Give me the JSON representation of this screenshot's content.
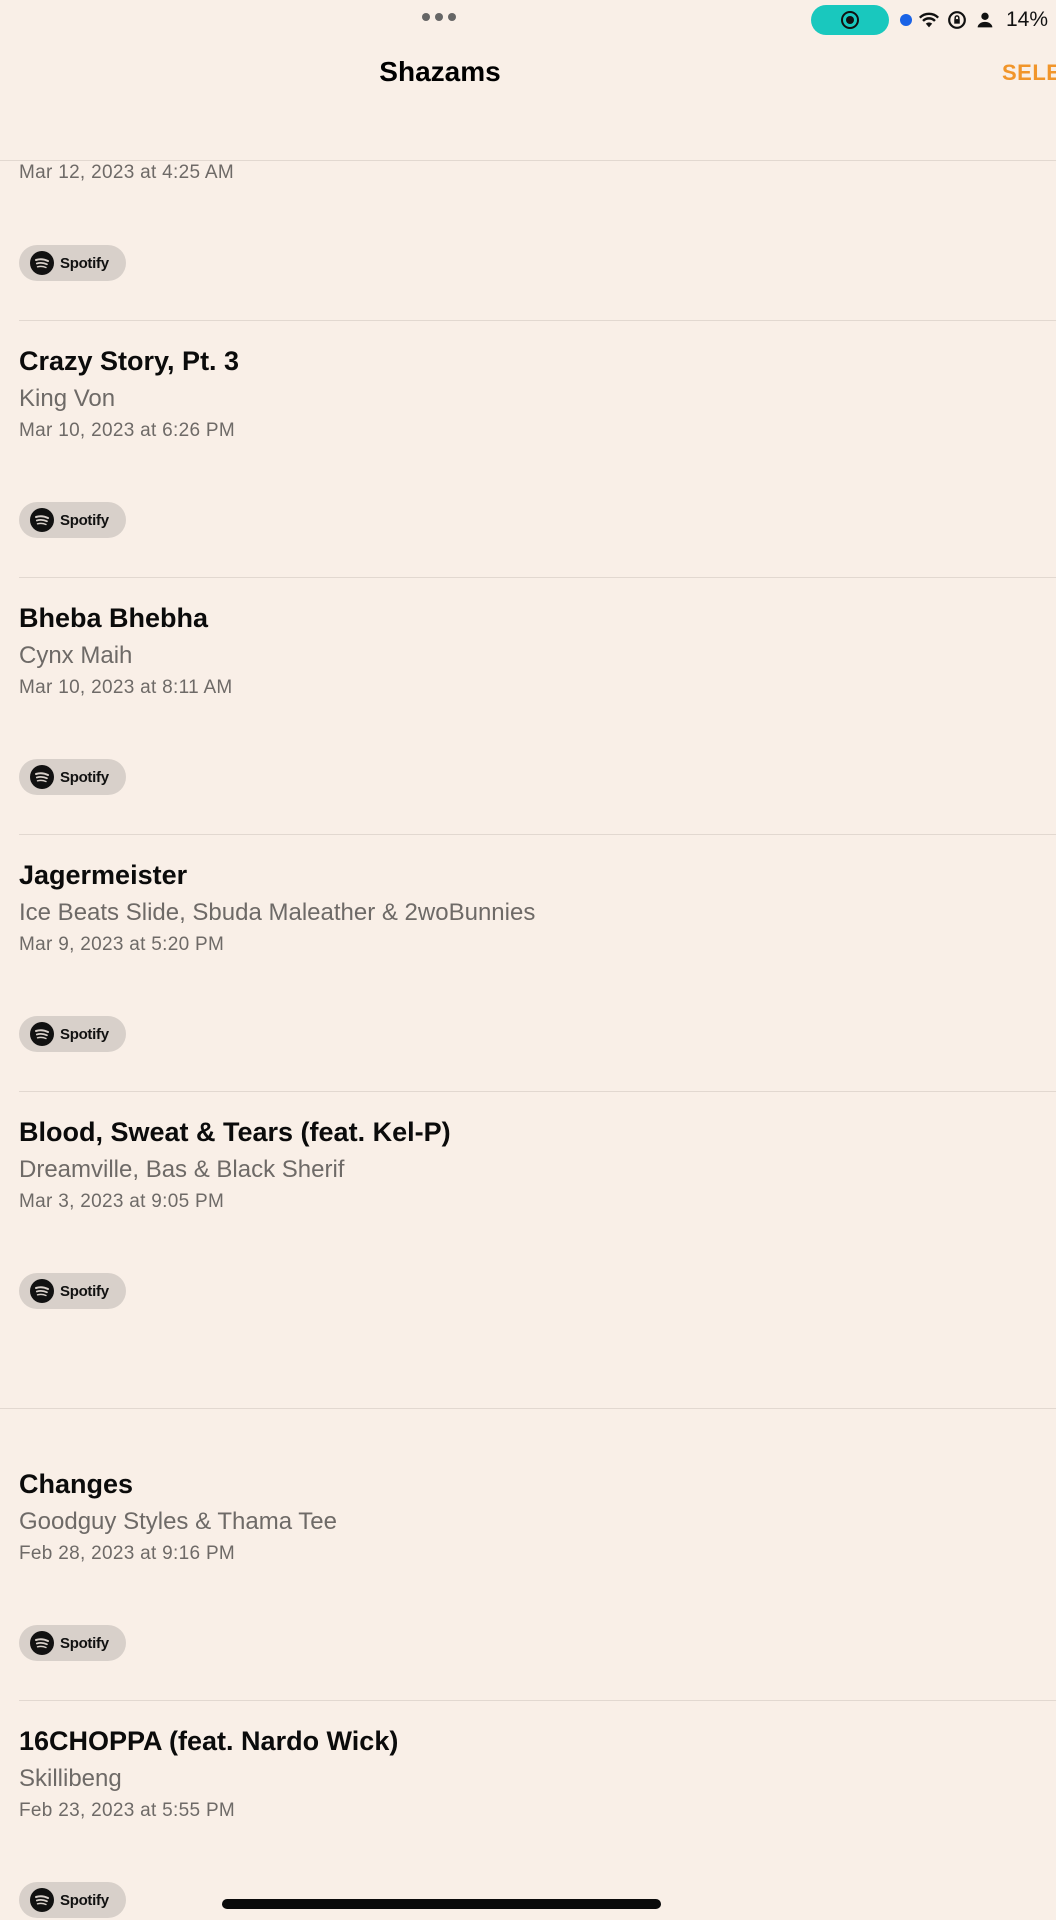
{
  "status_bar": {
    "battery": "14%",
    "colors": {
      "record_pill": "#19c8be",
      "dot": "#1a63e6"
    }
  },
  "header": {
    "title": "Shazams",
    "select_label": "SELE"
  },
  "accent_color": "#f1952a",
  "tracks": [
    {
      "title": "",
      "artist": "",
      "date": "Mar 12, 2023 at 4:25 AM",
      "service": "Spotify"
    },
    {
      "title": "Crazy Story, Pt. 3",
      "artist": "King Von",
      "date": "Mar 10, 2023 at 6:26 PM",
      "service": "Spotify"
    },
    {
      "title": "Bheba Bhebha",
      "artist": "Cynx Maih",
      "date": "Mar 10, 2023 at 8:11 AM",
      "service": "Spotify"
    },
    {
      "title": "Jagermeister",
      "artist": "Ice Beats Slide, Sbuda Maleather & 2woBunnies",
      "date": "Mar 9, 2023 at 5:20 PM",
      "service": "Spotify"
    },
    {
      "title": "Blood, Sweat & Tears (feat. Kel-P)",
      "artist": "Dreamville, Bas & Black Sherif",
      "date": "Mar 3, 2023 at 9:05 PM",
      "service": "Spotify"
    },
    {
      "title": "Changes",
      "artist": "Goodguy Styles & Thama Tee",
      "date": "Feb 28, 2023 at 9:16 PM",
      "service": "Spotify"
    },
    {
      "title": "16CHOPPA (feat. Nardo Wick)",
      "artist": "Skillibeng",
      "date": "Feb 23, 2023 at 5:55 PM",
      "service": "Spotify"
    }
  ]
}
